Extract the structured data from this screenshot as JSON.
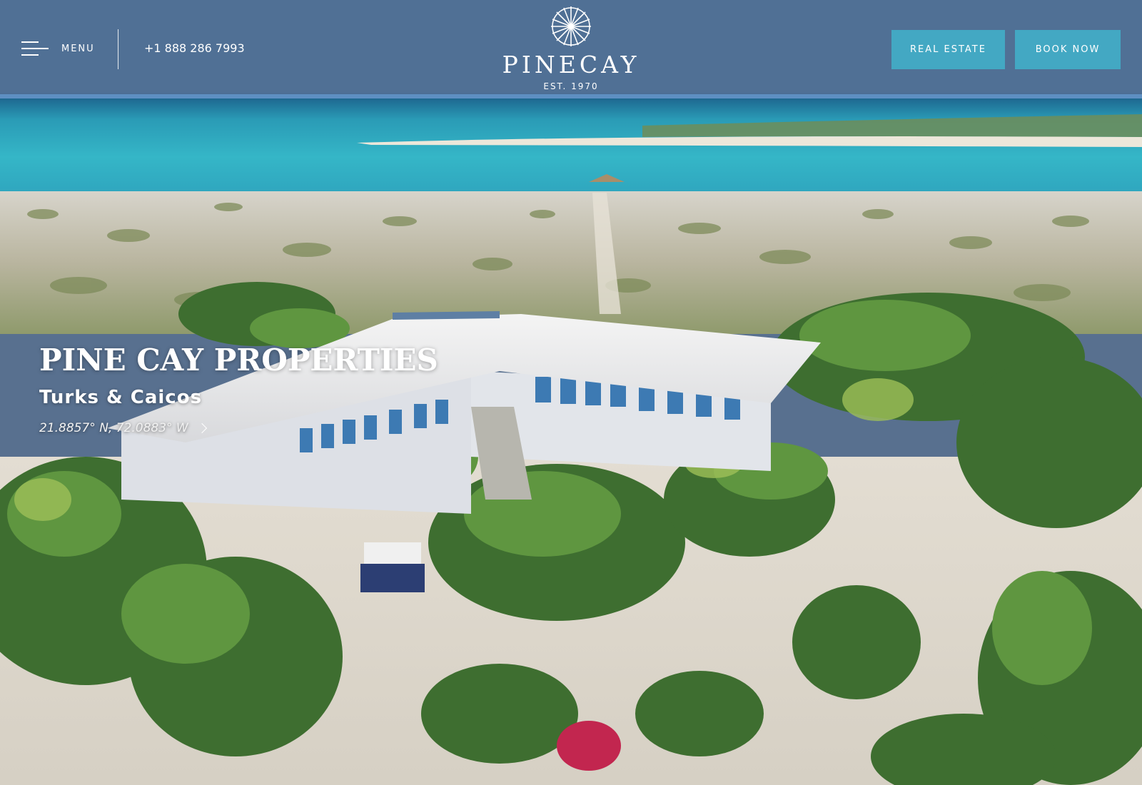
{
  "header": {
    "menu_label": "MENU",
    "phone": "+1 888 286 7993",
    "logo_word": "PINECAY",
    "logo_est": "EST. 1970",
    "buttons": {
      "real_estate": "REAL ESTATE",
      "book_now": "BOOK NOW"
    }
  },
  "hero": {
    "title": "PINE CAY PROPERTIES",
    "subtitle": "Turks & Caicos",
    "coordinates": "21.8857° N, 72.0883° W"
  },
  "colors": {
    "header_bg": "#50709a",
    "header_border": "#5e8fc2",
    "cta_bg": "#43a8c3",
    "text": "#ffffff"
  },
  "icons": {
    "menu": "hamburger-icon",
    "logo": "starburst-logo-icon",
    "coords_link": "chevron-right-icon"
  }
}
